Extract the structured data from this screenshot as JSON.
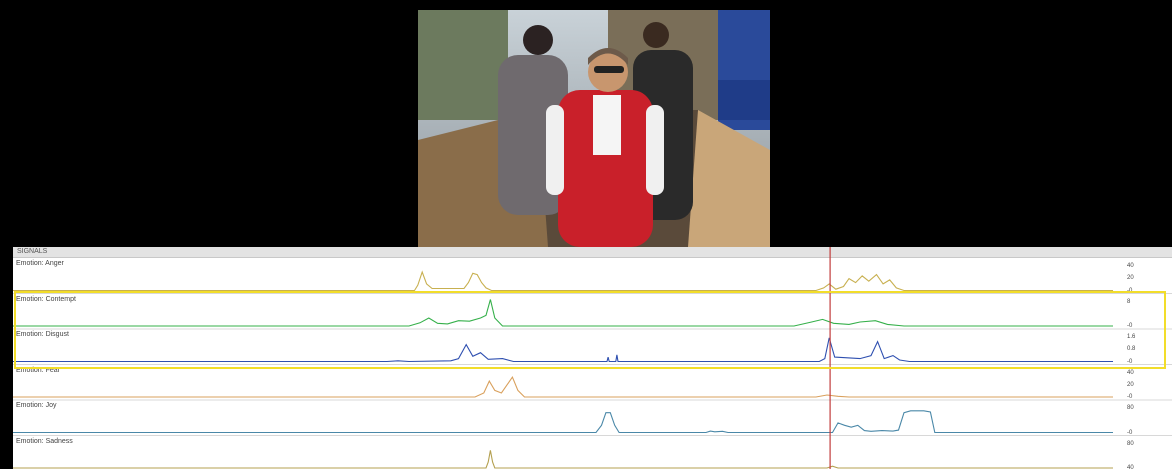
{
  "panel": {
    "title": "SIGNALS"
  },
  "playhead_fraction": 0.705,
  "colors": {
    "anger": "#c8b050",
    "contempt": "#35b04a",
    "disgust": "#2e4fb0",
    "fear": "#d9a05c",
    "joy": "#4a88a8",
    "sadness": "#b4a050",
    "playhead": "#c23b3b",
    "highlight": "#f2dd2a"
  },
  "tracks": [
    {
      "label": "Emotion: Anger",
      "color_key": "anger",
      "ticks": [
        "40",
        "20",
        "0"
      ],
      "max": 40,
      "points": [
        [
          0,
          0
        ],
        [
          0.365,
          0
        ],
        [
          0.368,
          8
        ],
        [
          0.372,
          28
        ],
        [
          0.376,
          10
        ],
        [
          0.381,
          3
        ],
        [
          0.41,
          3
        ],
        [
          0.414,
          12
        ],
        [
          0.418,
          26
        ],
        [
          0.422,
          24
        ],
        [
          0.426,
          12
        ],
        [
          0.43,
          4
        ],
        [
          0.435,
          0
        ],
        [
          0.73,
          0
        ],
        [
          0.737,
          4
        ],
        [
          0.742,
          10
        ],
        [
          0.748,
          2
        ],
        [
          0.755,
          6
        ],
        [
          0.76,
          18
        ],
        [
          0.766,
          12
        ],
        [
          0.772,
          22
        ],
        [
          0.778,
          14
        ],
        [
          0.785,
          24
        ],
        [
          0.791,
          10
        ],
        [
          0.797,
          16
        ],
        [
          0.803,
          4
        ],
        [
          0.81,
          0
        ],
        [
          1,
          0
        ]
      ]
    },
    {
      "label": "Emotion: Contempt",
      "color_key": "contempt",
      "ticks": [
        "8",
        "0"
      ],
      "max": 10,
      "points": [
        [
          0,
          0
        ],
        [
          0.36,
          0
        ],
        [
          0.37,
          1.2
        ],
        [
          0.378,
          3
        ],
        [
          0.386,
          1
        ],
        [
          0.395,
          0.8
        ],
        [
          0.405,
          2
        ],
        [
          0.415,
          1.8
        ],
        [
          0.425,
          3
        ],
        [
          0.43,
          4
        ],
        [
          0.434,
          10
        ],
        [
          0.438,
          3
        ],
        [
          0.445,
          0
        ],
        [
          0.71,
          0
        ],
        [
          0.726,
          1.5
        ],
        [
          0.736,
          2.5
        ],
        [
          0.746,
          1
        ],
        [
          0.76,
          0.6
        ],
        [
          0.77,
          1.5
        ],
        [
          0.784,
          2
        ],
        [
          0.795,
          0.6
        ],
        [
          0.81,
          0
        ],
        [
          1,
          0
        ]
      ]
    },
    {
      "label": "Emotion: Disgust",
      "color_key": "disgust",
      "ticks": [
        "1.6",
        "0.8",
        "0"
      ],
      "max": 1.8,
      "points": [
        [
          0,
          0
        ],
        [
          0.34,
          0
        ],
        [
          0.35,
          0.05
        ],
        [
          0.36,
          0
        ],
        [
          0.398,
          0.05
        ],
        [
          0.405,
          0.2
        ],
        [
          0.412,
          1.15
        ],
        [
          0.418,
          0.35
        ],
        [
          0.425,
          0.6
        ],
        [
          0.432,
          0.15
        ],
        [
          0.445,
          0.2
        ],
        [
          0.455,
          0
        ],
        [
          0.54,
          0
        ],
        [
          0.541,
          0.3
        ],
        [
          0.542,
          0
        ],
        [
          0.548,
          0
        ],
        [
          0.549,
          0.45
        ],
        [
          0.55,
          0
        ],
        [
          0.733,
          0
        ],
        [
          0.738,
          0.2
        ],
        [
          0.742,
          1.6
        ],
        [
          0.747,
          0.3
        ],
        [
          0.77,
          0.2
        ],
        [
          0.78,
          0.4
        ],
        [
          0.786,
          1.35
        ],
        [
          0.792,
          0.2
        ],
        [
          0.8,
          0.4
        ],
        [
          0.806,
          0.1
        ],
        [
          0.815,
          0
        ],
        [
          1,
          0
        ]
      ]
    },
    {
      "label": "Emotion: Fear",
      "color_key": "fear",
      "ticks": [
        "40",
        "20",
        "0"
      ],
      "max": 40,
      "points": [
        [
          0,
          0
        ],
        [
          0.42,
          0
        ],
        [
          0.428,
          6
        ],
        [
          0.433,
          24
        ],
        [
          0.438,
          10
        ],
        [
          0.444,
          6
        ],
        [
          0.449,
          18
        ],
        [
          0.454,
          30
        ],
        [
          0.459,
          10
        ],
        [
          0.465,
          0
        ],
        [
          0.73,
          0
        ],
        [
          0.74,
          3
        ],
        [
          0.75,
          1
        ],
        [
          0.76,
          0
        ],
        [
          1,
          0
        ]
      ]
    },
    {
      "label": "Emotion: Joy",
      "color_key": "joy",
      "ticks": [
        "80",
        "0"
      ],
      "max": 110,
      "points": [
        [
          0,
          0
        ],
        [
          0.53,
          0
        ],
        [
          0.535,
          30
        ],
        [
          0.539,
          82
        ],
        [
          0.543,
          82
        ],
        [
          0.547,
          30
        ],
        [
          0.551,
          0
        ],
        [
          0.63,
          0
        ],
        [
          0.634,
          6
        ],
        [
          0.638,
          3
        ],
        [
          0.645,
          5
        ],
        [
          0.65,
          0
        ],
        [
          0.745,
          0
        ],
        [
          0.75,
          40
        ],
        [
          0.756,
          30
        ],
        [
          0.762,
          22
        ],
        [
          0.768,
          30
        ],
        [
          0.774,
          8
        ],
        [
          0.78,
          5
        ],
        [
          0.79,
          8
        ],
        [
          0.8,
          6
        ],
        [
          0.805,
          10
        ],
        [
          0.81,
          82
        ],
        [
          0.816,
          90
        ],
        [
          0.828,
          90
        ],
        [
          0.834,
          85
        ],
        [
          0.838,
          0
        ],
        [
          1,
          0
        ]
      ]
    },
    {
      "label": "Emotion: Sadness",
      "color_key": "sadness",
      "ticks": [
        "80",
        "40"
      ],
      "max": 90,
      "points": [
        [
          0,
          0
        ],
        [
          0.43,
          0
        ],
        [
          0.432,
          20
        ],
        [
          0.434,
          60
        ],
        [
          0.436,
          20
        ],
        [
          0.438,
          0
        ],
        [
          0.74,
          0
        ],
        [
          0.745,
          6
        ],
        [
          0.75,
          0
        ],
        [
          1,
          0
        ]
      ]
    }
  ]
}
